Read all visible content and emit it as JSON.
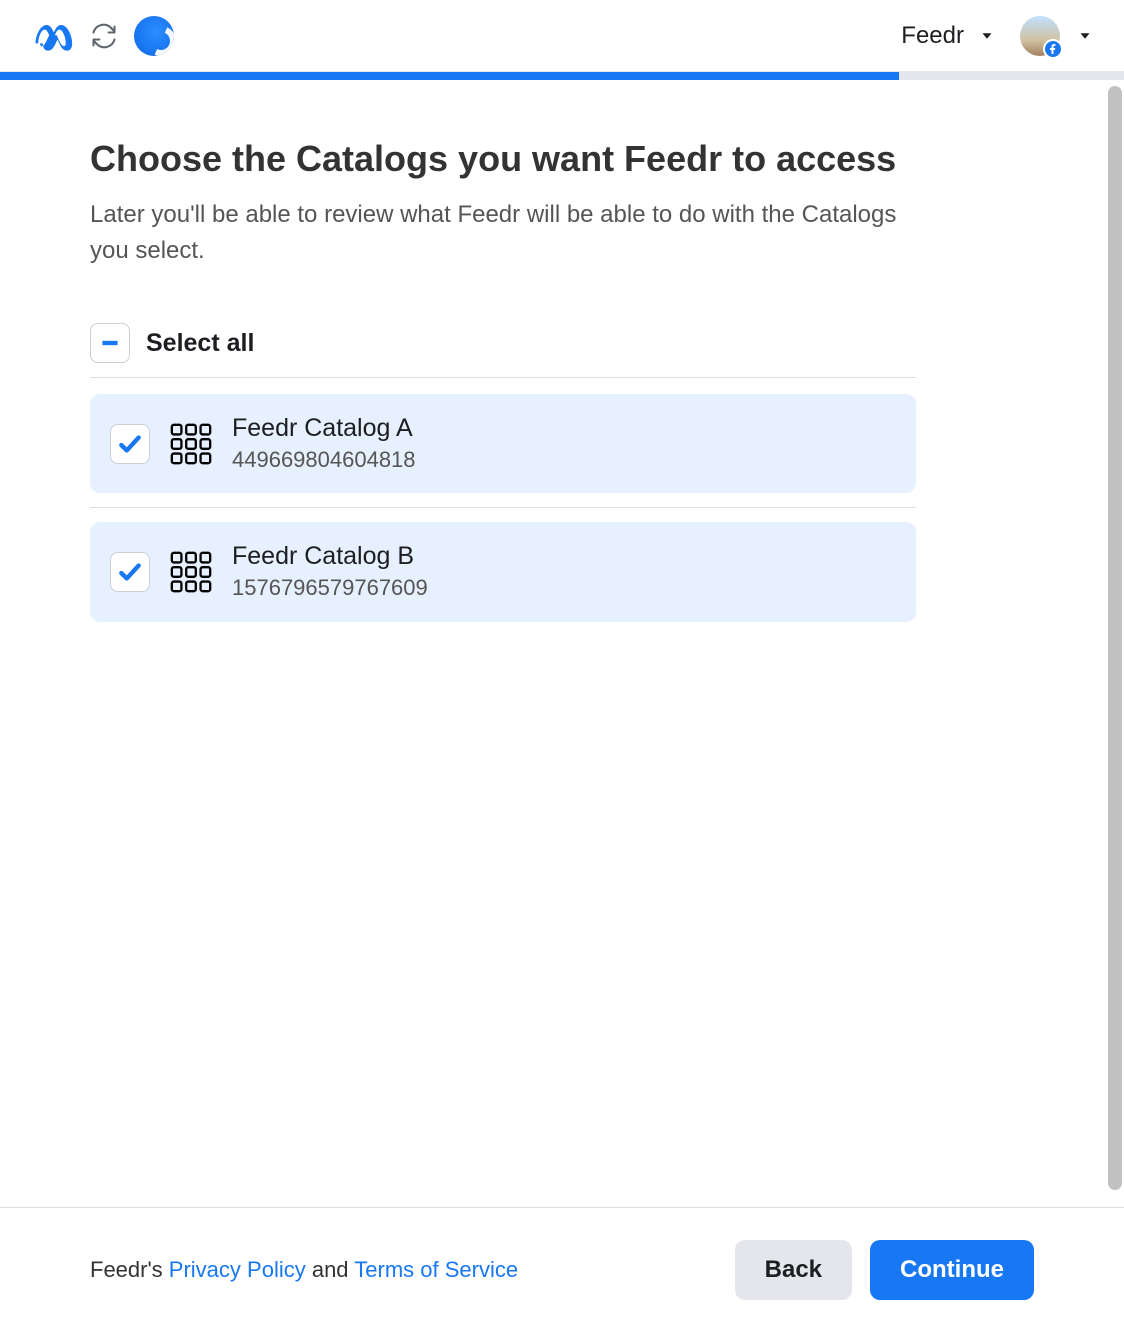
{
  "header": {
    "app_name": "Feedr"
  },
  "progress": {
    "percent": 80
  },
  "page": {
    "title": "Choose the Catalogs you want Feedr to access",
    "subtitle": "Later you'll be able to review what Feedr will be able to do with the Catalogs you select."
  },
  "select_all": {
    "label": "Select all",
    "state": "checked"
  },
  "catalogs": [
    {
      "name": "Feedr Catalog A",
      "id": "449669804604818",
      "checked": true
    },
    {
      "name": "Feedr Catalog B",
      "id": "1576796579767609",
      "checked": true
    }
  ],
  "footer": {
    "brand": "Feedr's ",
    "privacy": "Privacy Policy",
    "and": " and ",
    "terms": "Terms of Service",
    "back": "Back",
    "continue": "Continue"
  }
}
